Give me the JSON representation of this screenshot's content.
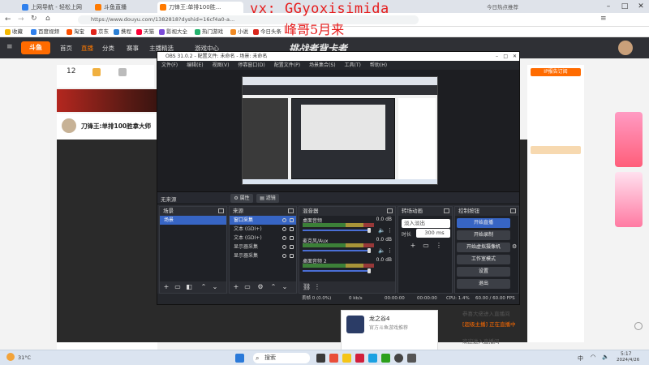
{
  "overlay": {
    "watermark_line1": "vx: GGyoxisimida",
    "watermark_line2": "峰哥5月来"
  },
  "browser": {
    "tabs": [
      "上网导航 - 轻松上网",
      "斗鱼直播",
      "刀锋王:单排100胜..."
    ],
    "url": "https://www.douyu.com/1382818?dyshid=16cf4a0-a...",
    "right_info": "今日热点推荐",
    "bookmarks": [
      "收藏",
      "百度视频",
      "淘宝",
      "京东",
      "携程",
      "天猫",
      "影视大全",
      "热门游戏",
      "小说",
      "今日头条"
    ]
  },
  "site": {
    "logo": "斗鱼",
    "nav": [
      "首页",
      "直播",
      "分类",
      "赛事",
      "主播精选",
      "游戏中心"
    ],
    "banner_text": "挑战者背卡者",
    "follow_count": "12",
    "streamer_title": "刀锋王:单排100胜拿大师",
    "right_header": "IP报告订阅",
    "bottom_card_title": "龙之谷4",
    "bottom_card_sub": "官方斗鱼游戏推荐",
    "chat_lines": [
      "恭喜大佬进入直播间",
      "[超级主播] 正在直播中",
      "欢迎进入直播间"
    ]
  },
  "obs": {
    "title": "OBS 31.0.2 - 配置文件: 未命名 - 场景: 未命名",
    "menu": [
      "文件(F)",
      "编辑(E)",
      "视图(V)",
      "停靠窗口(D)",
      "配置文件(P)",
      "场景集合(S)",
      "工具(T)",
      "帮助(H)"
    ],
    "scenebar_label": "无来源",
    "scenebar_btn1": "属性",
    "scenebar_btn2": "滤镜",
    "docks": {
      "scenes": {
        "title": "场景",
        "items": [
          "场景"
        ]
      },
      "sources": {
        "title": "来源",
        "items": [
          "窗口采集",
          "文本 (GDI+)",
          "文本 (GDI+)",
          "显示器采集",
          "显示器采集"
        ]
      },
      "mixer": {
        "title": "混音器",
        "channels": [
          {
            "name": "桌面音频",
            "db": "0.0 dB"
          },
          {
            "name": "麦克风/Aux",
            "db": "0.0 dB"
          },
          {
            "name": "桌面音频 2",
            "db": "0.0 dB"
          }
        ]
      },
      "transitions": {
        "title": "转场动画",
        "type": "淡入淡出",
        "duration_label": "时长",
        "duration": "300 ms"
      },
      "controls": {
        "title": "控制按钮",
        "buttons": [
          "开始直播",
          "开始录制",
          "开始虚拟摄像机",
          "工作室模式",
          "设置",
          "退出"
        ]
      }
    },
    "status": {
      "dropped": "丢帧 0 (0.0%)",
      "net": "0 kb/s",
      "time1": "00:00:00",
      "time2": "00:00:00",
      "cpu": "CPU: 1.4%",
      "fps": "60.00 / 60.00 FPS"
    }
  },
  "taskbar": {
    "weather": "31°C",
    "search": "搜索",
    "tray_lang": "中",
    "time": "5:17",
    "date": "2024/4/26"
  }
}
